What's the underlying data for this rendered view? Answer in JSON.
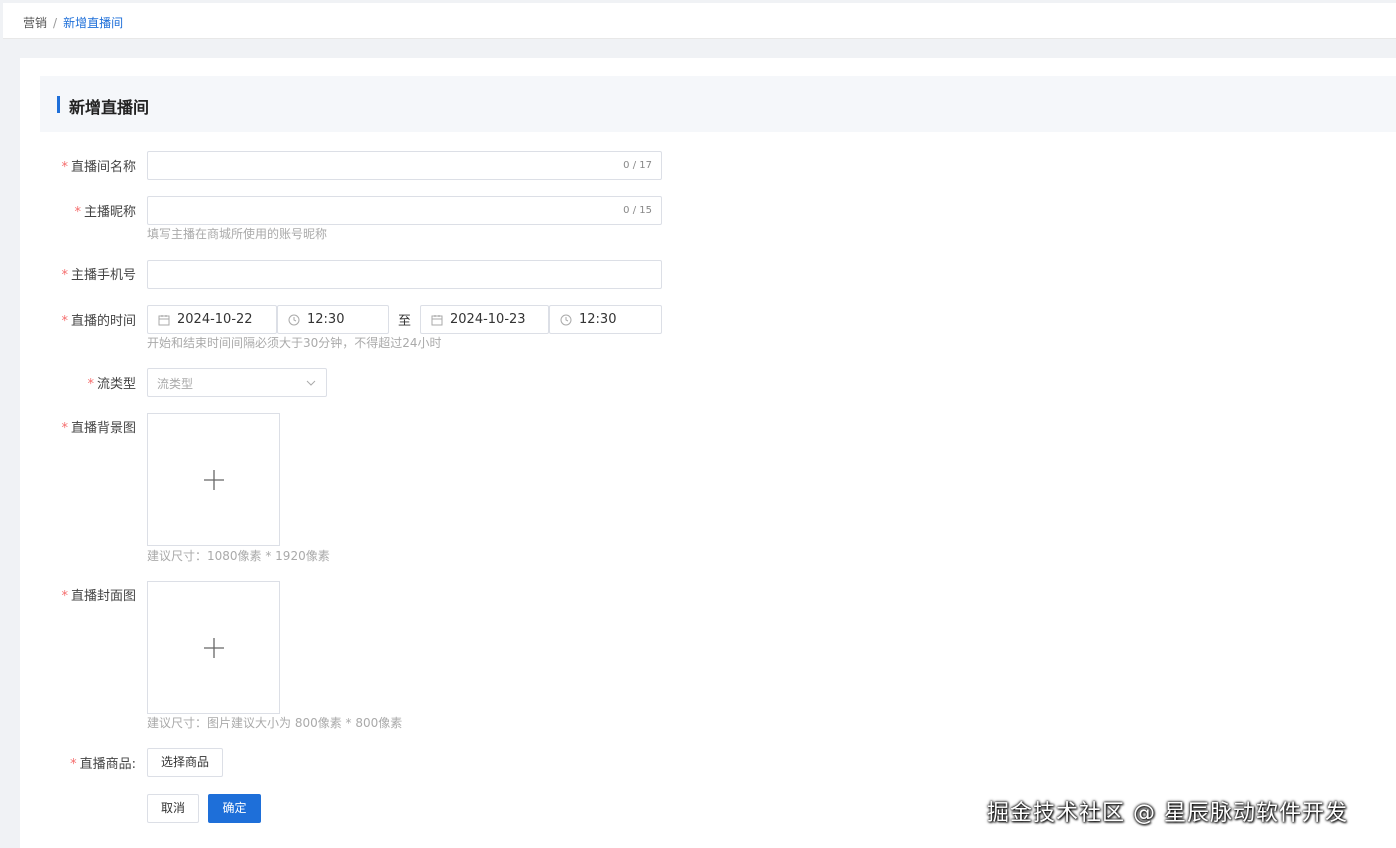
{
  "breadcrumb": {
    "parent": "营销",
    "separator": "/",
    "current": "新增直播间"
  },
  "section": {
    "title": "新增直播间"
  },
  "form": {
    "room_name": {
      "label": "直播间名称",
      "counter": "0 / 17"
    },
    "anchor_nick": {
      "label": "主播昵称",
      "counter": "0 / 15",
      "hint": "填写主播在商城所使用的账号昵称"
    },
    "anchor_phone": {
      "label": "主播手机号"
    },
    "live_time": {
      "label": "直播的时间",
      "start_date": "2024-10-22",
      "start_time": "12:30",
      "to": "至",
      "end_date": "2024-10-23",
      "end_time": "12:30",
      "hint": "开始和结束时间间隔必须大于30分钟，不得超过24小时"
    },
    "stream_type": {
      "label": "流类型",
      "placeholder": "流类型"
    },
    "bg_image": {
      "label": "直播背景图",
      "hint": "建议尺寸：1080像素 * 1920像素"
    },
    "cover_image": {
      "label": "直播封面图",
      "hint": "建议尺寸：图片建议大小为 800像素 * 800像素"
    },
    "products": {
      "label": "直播商品:",
      "button": "选择商品"
    }
  },
  "actions": {
    "cancel": "取消",
    "confirm": "确定"
  },
  "watermark": "掘金技术社区 @ 星辰脉动软件开发",
  "colors": {
    "primary": "#1e6fd9",
    "required": "#f56c6c",
    "border": "#dcdfe6"
  }
}
